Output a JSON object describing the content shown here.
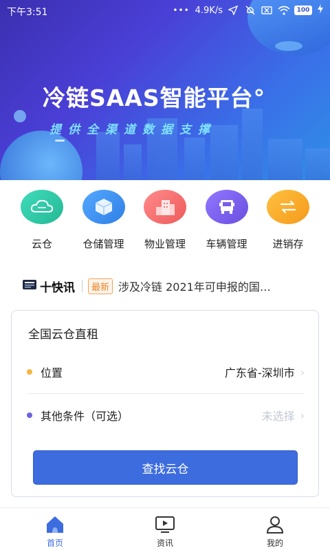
{
  "status_bar": {
    "time": "下午3:51",
    "network_speed": "4.9K/s",
    "battery": "100"
  },
  "banner": {
    "title": "冷链SAAS智能平台°",
    "subtitle": "提供全渠道数据支撑"
  },
  "categories": [
    {
      "label": "云仓",
      "icon": "cloud-icon",
      "color": "#2fc9a6"
    },
    {
      "label": "仓储管理",
      "icon": "box-icon",
      "color": "#3b8ff0"
    },
    {
      "label": "物业管理",
      "icon": "building-icon",
      "color": "#f06a6a"
    },
    {
      "label": "车辆管理",
      "icon": "truck-icon",
      "color": "#7a5ee8"
    },
    {
      "label": "进销存",
      "icon": "exchange-icon",
      "color": "#f5a623"
    }
  ],
  "news": {
    "logo_text": "十快讯",
    "badge": "最新",
    "headline": "涉及冷链 2021年可申报的国…"
  },
  "search_card": {
    "title": "全国云仓直租",
    "location_label": "位置",
    "location_value": "广东省-深圳市",
    "location_dot_color": "#f5b540",
    "conditions_label": "其他条件（可选）",
    "conditions_value": "未选择",
    "conditions_dot_color": "#6b62e0",
    "search_button": "查找云仓"
  },
  "bottom_nav": [
    {
      "label": "首页",
      "icon": "home-icon",
      "active": true
    },
    {
      "label": "资讯",
      "icon": "video-icon",
      "active": false
    },
    {
      "label": "我的",
      "icon": "user-icon",
      "active": false
    }
  ],
  "colors": {
    "accent": "#3d6cdf",
    "nav_active": "#3d6cdf",
    "nav_inactive": "#333333",
    "placeholder": "#c4c8d4"
  }
}
